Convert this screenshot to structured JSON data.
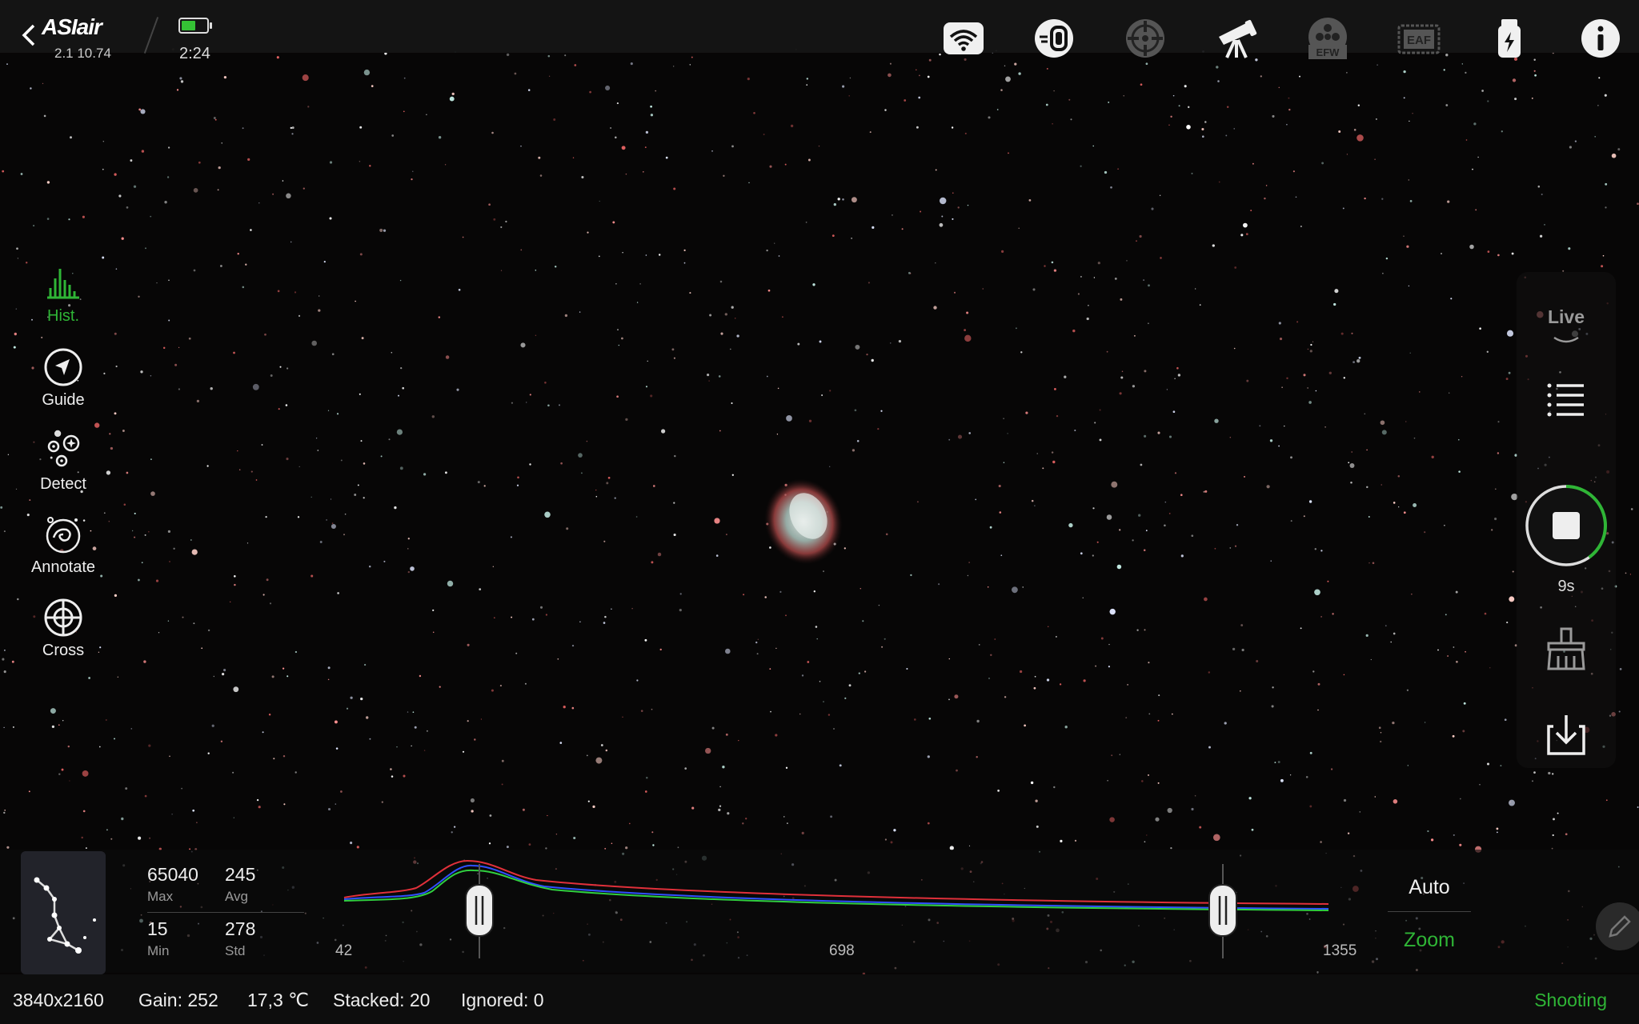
{
  "header": {
    "app_logo": "ASIair",
    "version": "2.1 10.74",
    "battery_time": "2:24",
    "battery_level": 0.55,
    "icons": [
      "back-icon",
      "wifi-icon",
      "camera-icon",
      "guide-scope-icon",
      "telescope-mount-icon",
      "filter-wheel-icon",
      "focuser-icon",
      "usb-power-icon",
      "info-icon"
    ],
    "efw_label": "EFW",
    "eaf_label": "EAF"
  },
  "left_tools": [
    {
      "label": "Hist.",
      "icon": "histogram-icon",
      "active": true
    },
    {
      "label": "Guide",
      "icon": "guide-icon",
      "active": false
    },
    {
      "label": "Detect",
      "icon": "detect-stars-icon",
      "active": false
    },
    {
      "label": "Annotate",
      "icon": "annotate-galaxy-icon",
      "active": false
    },
    {
      "label": "Cross",
      "icon": "crosshair-icon",
      "active": false
    }
  ],
  "right_panel": {
    "mode": "Live",
    "countdown": "9s",
    "exposure_progress": 0.4,
    "icons": [
      "chevron-down-icon",
      "list-icon",
      "stop-icon",
      "sweep-icon",
      "download-icon"
    ]
  },
  "histogram": {
    "max": "65040",
    "max_label": "Max",
    "avg": "245",
    "avg_label": "Avg",
    "min": "15",
    "min_label": "Min",
    "std": "278",
    "std_label": "Std",
    "axis_left": "42",
    "axis_mid": "698",
    "axis_right": "1355",
    "auto_label": "Auto",
    "zoom_label": "Zoom",
    "colors": {
      "red": "#e0303a",
      "green": "#30d040",
      "blue": "#3050ff"
    }
  },
  "status": {
    "resolution": "3840x2160",
    "gain": "Gain: 252",
    "temperature": "17,3 ℃",
    "stacked": "Stacked: 20",
    "ignored": "Ignored: 0",
    "state": "Shooting"
  },
  "colors": {
    "accent": "#2fb536"
  }
}
